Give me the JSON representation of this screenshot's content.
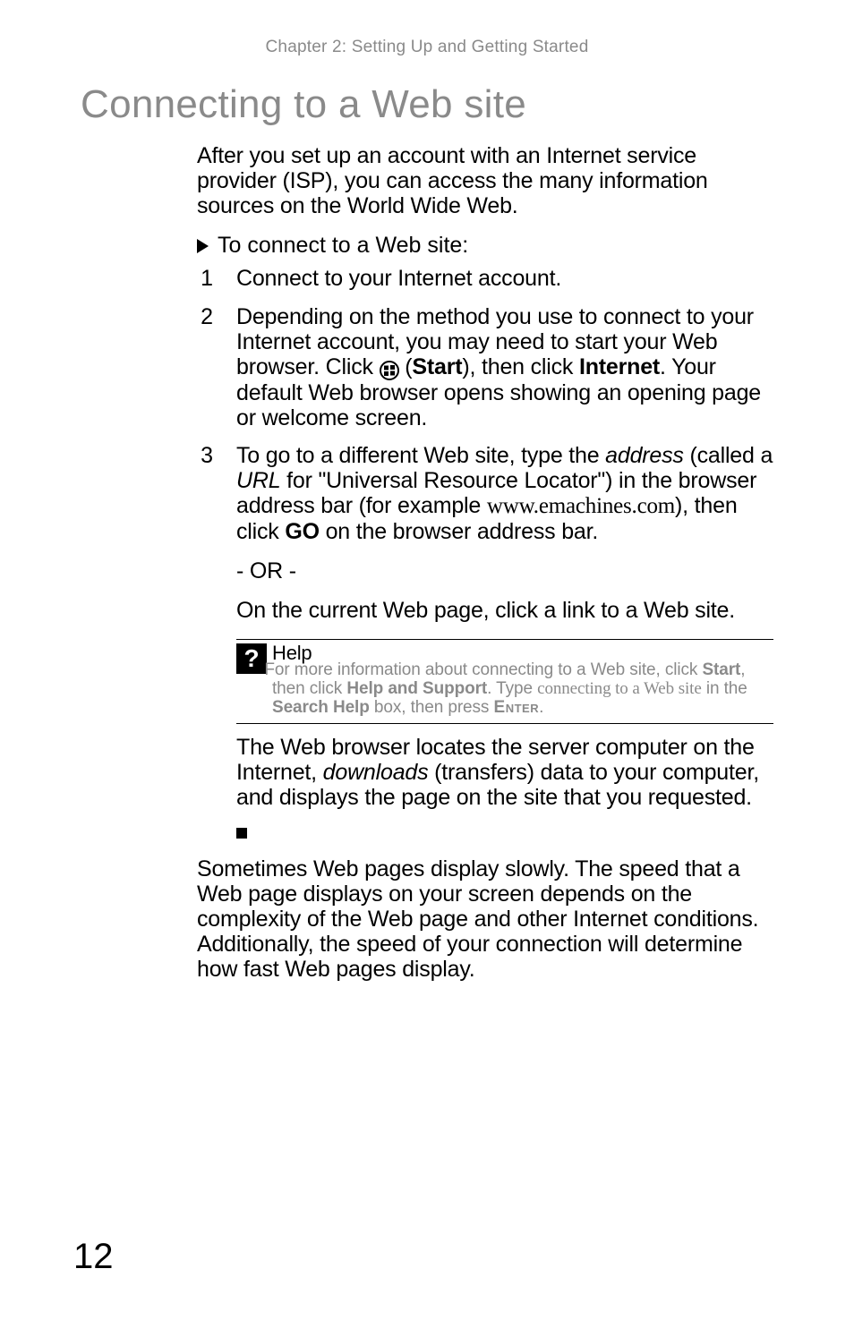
{
  "chapter_header": "Chapter 2: Setting Up and Getting Started",
  "h1": "Connecting to a Web site",
  "intro": "After you set up an account with an Internet service provider (ISP), you can access the many information sources on the World Wide Web.",
  "task_line": "To connect to a Web site:",
  "steps": {
    "s1": "Connect to your Internet account.",
    "s2_a": "Depending on the method you use to connect to your Internet account, you may need to start your Web browser. Click ",
    "s2_b": " (",
    "s2_start": "Start",
    "s2_c": "), then click ",
    "s2_internet": "Internet",
    "s2_d": ". Your default Web browser opens showing an opening page or welcome screen.",
    "s3_a": "To go to a different Web site, type the ",
    "s3_address": "address",
    "s3_b": " (called a ",
    "s3_url": "URL",
    "s3_c": " for \"Universal Resource Locator\") in the browser address bar (for example ",
    "s3_site": "www.emachines.com",
    "s3_d": "), then click ",
    "s3_go": "GO",
    "s3_e": " on the browser address bar.",
    "s3_or": "- OR -",
    "s3_or_line": "On the current Web page, click a link to a Web site."
  },
  "help": {
    "icon": "?",
    "title": "Help",
    "a": "For more information about connecting to a Web site, click ",
    "start": "Start",
    "b": ", then click ",
    "hs": "Help and Support",
    "c": ". Type ",
    "kw": "connecting to a Web site",
    "d": " in the ",
    "sh": "Search Help",
    "e": " box, then press ",
    "enter": "Enter",
    "f": "."
  },
  "after_help_a": "The Web browser locates the server computer on the Internet, ",
  "after_help_dl": "downloads",
  "after_help_b": " (transfers) data to your computer, and displays the page on the site that you requested.",
  "closing": "Sometimes Web pages display slowly. The speed that a Web page displays on your screen depends on the complexity of the Web page and other Internet conditions. Additionally, the speed of your connection will determine how fast Web pages display.",
  "page_number": "12"
}
